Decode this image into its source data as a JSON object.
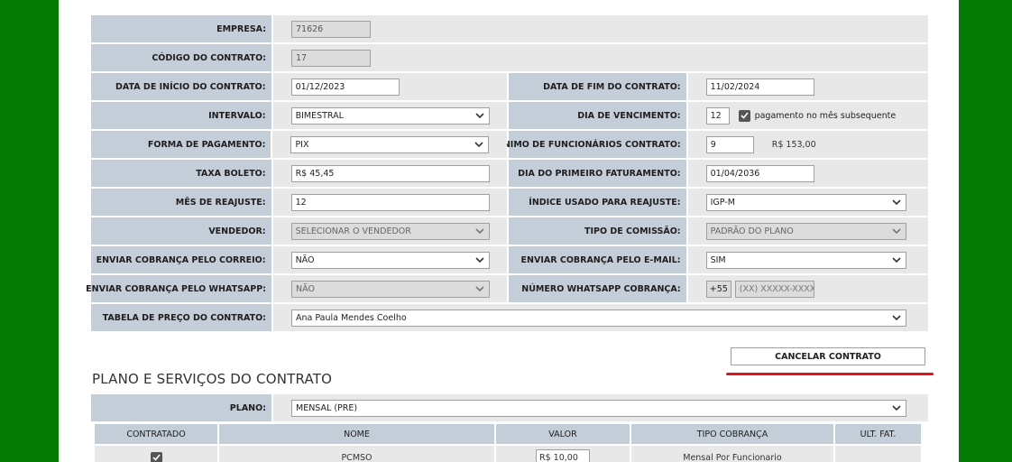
{
  "contract": {
    "empresa": {
      "label": "EMPRESA:",
      "value": "71626"
    },
    "codigo": {
      "label": "CÓDIGO DO CONTRATO:",
      "value": "17"
    },
    "data_inicio": {
      "label": "DATA DE INÍCIO DO CONTRATO:",
      "value": "01/12/2023"
    },
    "data_fim": {
      "label": "DATA DE FIM DO CONTRATO:",
      "value": "11/02/2024"
    },
    "intervalo": {
      "label": "INTERVALO:",
      "value": "BIMESTRAL"
    },
    "dia_vencimento": {
      "label": "DIA DE VENCIMENTO:",
      "value": "12",
      "checkbox_label": "pagamento no mês subsequente",
      "checked": true
    },
    "forma_pagamento": {
      "label": "FORMA DE PAGAMENTO:",
      "value": "PIX"
    },
    "minimo_funcionarios": {
      "label": "MÍNIMO DE FUNCIONÁRIOS CONTRATO:",
      "value": "9",
      "amount": "R$ 153,00"
    },
    "taxa_boleto": {
      "label": "TAXA BOLETO:",
      "value": "R$ 45,45"
    },
    "primeiro_faturamento": {
      "label": "DIA DO PRIMEIRO FATURAMENTO:",
      "value": "01/04/2036"
    },
    "mes_reajuste": {
      "label": "MÊS DE REAJUSTE:",
      "value": "12"
    },
    "indice_reajuste": {
      "label": "ÍNDICE USADO PARA REAJUSTE:",
      "value": "IGP-M"
    },
    "vendedor": {
      "label": "VENDEDOR:",
      "value": "SELECIONAR O VENDEDOR"
    },
    "tipo_comissao": {
      "label": "TIPO DE COMISSÃO:",
      "value": "PADRÃO DO PLANO"
    },
    "cobranca_correio": {
      "label": "ENVIAR COBRANÇA PELO CORREIO:",
      "value": "NÃO"
    },
    "cobranca_email": {
      "label": "ENVIAR COBRANÇA PELO E-MAIL:",
      "value": "SIM"
    },
    "cobranca_whatsapp": {
      "label": "ENVIAR COBRANÇA PELO WHATSAPP:",
      "value": "NÃO"
    },
    "numero_whatsapp": {
      "label": "NÚMERO WHATSAPP COBRANÇA:",
      "prefix": "+55",
      "placeholder": "(XX) XXXXX-XXXX"
    },
    "tabela_preco": {
      "label": "TABELA DE PREÇO DO CONTRATO:",
      "value": "Ana Paula Mendes Coelho"
    }
  },
  "actions": {
    "cancel_label": "CANCELAR CONTRATO"
  },
  "plan_section": {
    "title": "PLANO E SERVIÇOS DO CONTRATO",
    "plano_label": "PLANO:",
    "plano_value": "MENSAL (PRE)"
  },
  "services": {
    "headers": [
      "CONTRATADO",
      "NOME",
      "VALOR",
      "TIPO COBRANÇA",
      "ULT. FAT."
    ],
    "rows": [
      {
        "checked": true,
        "nome": "PCMSO",
        "valor": "R$ 10,00",
        "tipo": "Mensal Por Funcionario",
        "ult": ""
      }
    ]
  },
  "colors": {
    "background": "#047a04",
    "label_bg": "#c4ced9",
    "value_bg": "#e8e8e8",
    "accent_red": "#e0141e",
    "checkbox": "#555555"
  }
}
